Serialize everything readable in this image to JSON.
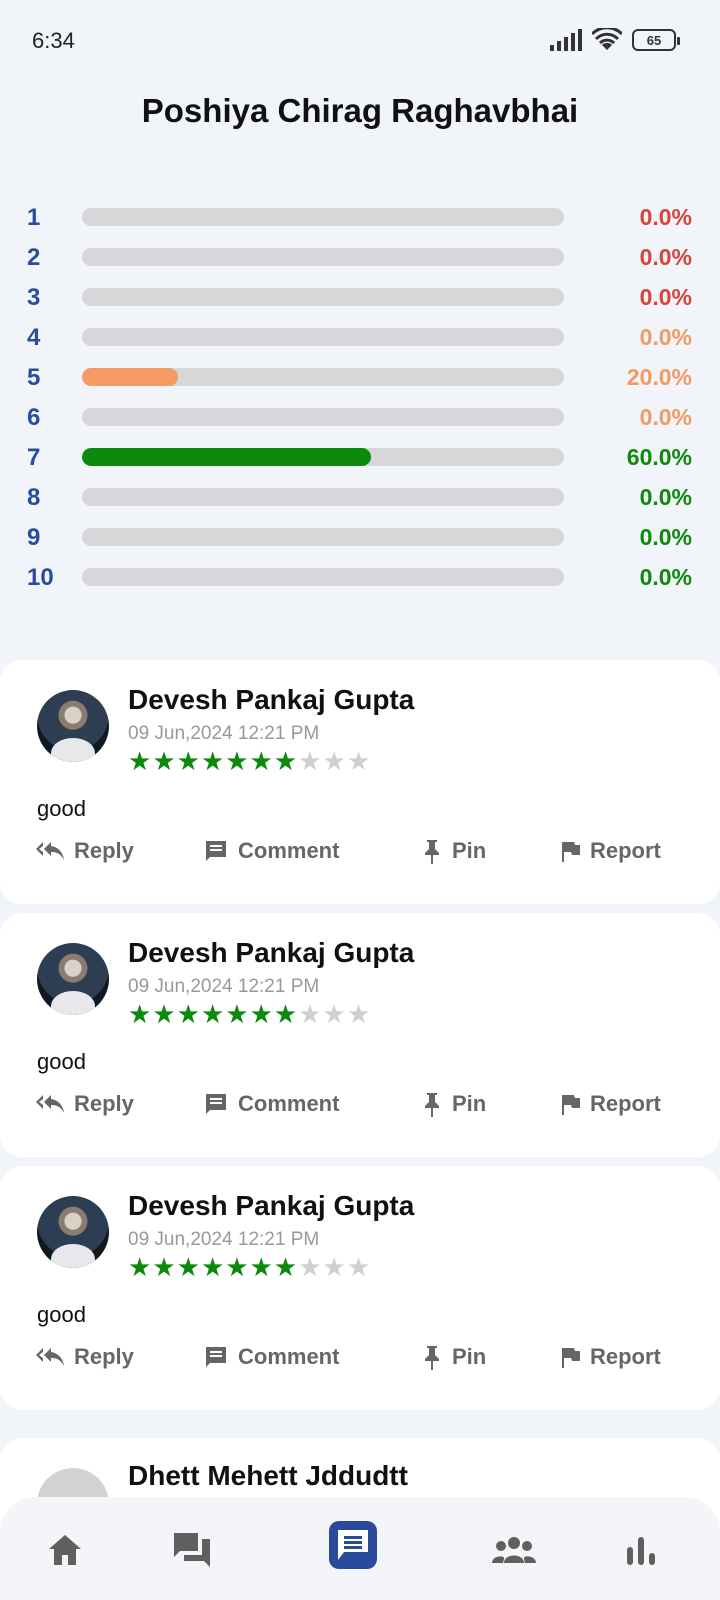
{
  "status_bar": {
    "time": "6:34",
    "battery": "65"
  },
  "header": {
    "title": "Poshiya Chirag Raghavbhai"
  },
  "colors": {
    "accent": "#2b4c9e",
    "red": "#d9433a",
    "orange": "#f08a55",
    "green": "#0c8a0c",
    "track": "#d8d6d8"
  },
  "distribution": [
    {
      "label": "1",
      "percent_text": "0.0%",
      "fill": 0.0,
      "color": "#d9433a"
    },
    {
      "label": "2",
      "percent_text": "0.0%",
      "fill": 0.0,
      "color": "#d9433a"
    },
    {
      "label": "3",
      "percent_text": "0.0%",
      "fill": 0.0,
      "color": "#d9433a"
    },
    {
      "label": "4",
      "percent_text": "0.0%",
      "fill": 0.0,
      "color": "#f59a63"
    },
    {
      "label": "5",
      "percent_text": "20.0%",
      "fill": 0.2,
      "color": "#f59a63"
    },
    {
      "label": "6",
      "percent_text": "0.0%",
      "fill": 0.0,
      "color": "#f59a63"
    },
    {
      "label": "7",
      "percent_text": "60.0%",
      "fill": 0.6,
      "color": "#0c8a0c"
    },
    {
      "label": "8",
      "percent_text": "0.0%",
      "fill": 0.0,
      "color": "#0c8a0c"
    },
    {
      "label": "9",
      "percent_text": "0.0%",
      "fill": 0.0,
      "color": "#0c8a0c"
    },
    {
      "label": "10",
      "percent_text": "0.0%",
      "fill": 0.0,
      "color": "#0c8a0c"
    }
  ],
  "actions": {
    "reply": "Reply",
    "comment": "Comment",
    "pin": "Pin",
    "report": "Report"
  },
  "reviews": [
    {
      "name": "Devesh Pankaj Gupta",
      "date": "09 Jun,2024 12:21 PM",
      "rating": 7,
      "max_rating": 10,
      "text": "good"
    },
    {
      "name": "Devesh Pankaj Gupta",
      "date": "09 Jun,2024 12:21 PM",
      "rating": 7,
      "max_rating": 10,
      "text": "good"
    },
    {
      "name": "Devesh Pankaj Gupta",
      "date": "09 Jun,2024 12:21 PM",
      "rating": 7,
      "max_rating": 10,
      "text": "good"
    }
  ],
  "partial_review": {
    "name": "Dhett Mehett Jddudtt"
  },
  "bottom_nav": {
    "items": [
      {
        "icon": "home-icon"
      },
      {
        "icon": "forum-icon"
      },
      {
        "icon": "reviews-icon",
        "active": true
      },
      {
        "icon": "group-icon"
      },
      {
        "icon": "bar-chart-icon"
      }
    ]
  }
}
